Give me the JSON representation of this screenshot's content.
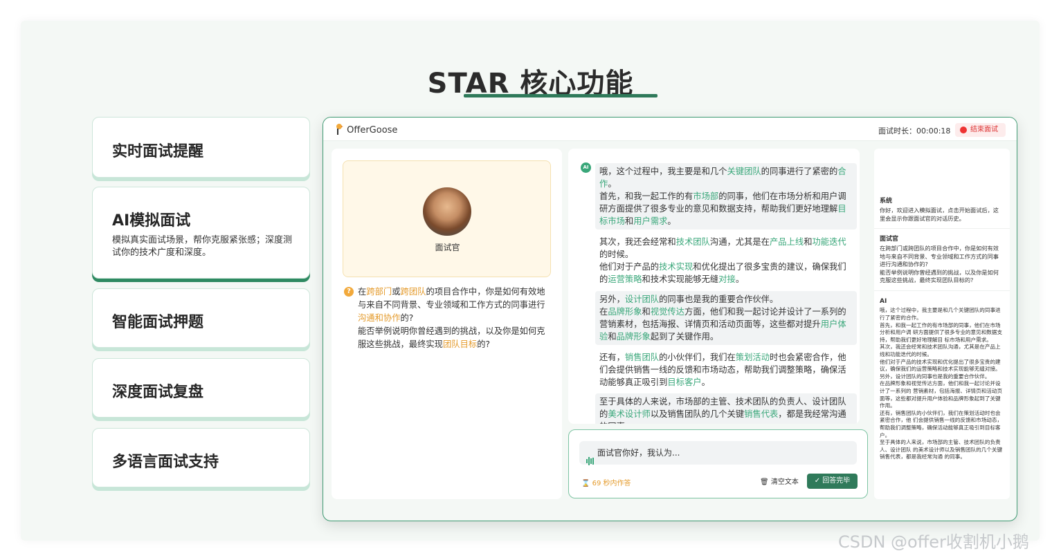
{
  "page_title": "STAR 核心功能",
  "features": [
    {
      "title": "实时面试提醒",
      "desc": ""
    },
    {
      "title": "AI模拟面试",
      "desc": "模拟真实面试场景，帮你克服紧张感；深度测试你的技术广度和深度。"
    },
    {
      "title": "智能面试押题",
      "desc": ""
    },
    {
      "title": "深度面试复盘",
      "desc": ""
    },
    {
      "title": "多语言面试支持",
      "desc": ""
    }
  ],
  "app": {
    "brand": "OfferGoose",
    "timer_label": "面试时长：00:00:18",
    "end_button": "结束面试",
    "interviewer_label": "面试官",
    "question_segments": [
      {
        "t": "在",
        "c": ""
      },
      {
        "t": "跨部门",
        "c": "o"
      },
      {
        "t": "或",
        "c": ""
      },
      {
        "t": "跨团队",
        "c": "o"
      },
      {
        "t": "的项目合作中，你是如何有效地与来自不同背景、专业领域和工作方式的同事进行",
        "c": ""
      },
      {
        "t": "沟通和协作",
        "c": "o"
      },
      {
        "t": "的?",
        "c": ""
      },
      {
        "t": "\n能否举例说明你曾经遇到的挑战，以及你是如何克服这些挑战，最终实现",
        "c": ""
      },
      {
        "t": "团队目标",
        "c": "o"
      },
      {
        "t": "的?",
        "c": ""
      }
    ],
    "ai_badge": "AI",
    "answer_blocks": [
      {
        "gray": true,
        "segments": [
          {
            "t": "哦，这个过程中，我主要是和几个",
            "c": ""
          },
          {
            "t": "关键团队",
            "c": "g"
          },
          {
            "t": "的同事进行了紧密的",
            "c": ""
          },
          {
            "t": "合作",
            "c": "g"
          },
          {
            "t": "。\n首先，和我一起工作的有",
            "c": ""
          },
          {
            "t": "市场部",
            "c": "g"
          },
          {
            "t": "的同事，他们在市场分析和用户调研方面提供了很多专业的意见和数据支持，帮助我们更好地理解",
            "c": ""
          },
          {
            "t": "目标市场",
            "c": "g"
          },
          {
            "t": "和",
            "c": ""
          },
          {
            "t": "用户需求",
            "c": "g"
          },
          {
            "t": "。",
            "c": ""
          }
        ]
      },
      {
        "gray": false,
        "segments": [
          {
            "t": "其次，我还会经常和",
            "c": ""
          },
          {
            "t": "技术团队",
            "c": "g"
          },
          {
            "t": "沟通，尤其是在",
            "c": ""
          },
          {
            "t": "产品上线",
            "c": "g"
          },
          {
            "t": "和",
            "c": ""
          },
          {
            "t": "功能迭代",
            "c": "g"
          },
          {
            "t": "的时候。\n他们对于产品的",
            "c": ""
          },
          {
            "t": "技术实现",
            "c": "g"
          },
          {
            "t": "和优化提出了很多宝贵的建议，确保我们的",
            "c": ""
          },
          {
            "t": "运营策略",
            "c": "g"
          },
          {
            "t": "和技术实现能够无缝",
            "c": ""
          },
          {
            "t": "对接",
            "c": "g"
          },
          {
            "t": "。",
            "c": ""
          }
        ]
      },
      {
        "gray": true,
        "segments": [
          {
            "t": "另外，",
            "c": ""
          },
          {
            "t": "设计团队",
            "c": "g"
          },
          {
            "t": "的同事也是我的重要合作伙伴。\n在",
            "c": ""
          },
          {
            "t": "品牌形象",
            "c": "g"
          },
          {
            "t": "和",
            "c": ""
          },
          {
            "t": "视觉传达",
            "c": "g"
          },
          {
            "t": "方面，他们和我一起讨论并设计了一系列的营销素材，包括海报、详情页和活动页面等，这些都对提升",
            "c": ""
          },
          {
            "t": "用户体验",
            "c": "g"
          },
          {
            "t": "和",
            "c": ""
          },
          {
            "t": "品牌形象",
            "c": "g"
          },
          {
            "t": "起到了关键作用。",
            "c": ""
          }
        ]
      },
      {
        "gray": false,
        "segments": [
          {
            "t": "还有，",
            "c": ""
          },
          {
            "t": "销售团队",
            "c": "g"
          },
          {
            "t": "的小伙伴们，我们在",
            "c": ""
          },
          {
            "t": "策划活动",
            "c": "g"
          },
          {
            "t": "时也会紧密合作，他们会提供销售一线的反馈和市场动态，帮助我们调整策略，确保活动能够真正吸引到",
            "c": ""
          },
          {
            "t": "目标客户",
            "c": "g"
          },
          {
            "t": "。",
            "c": ""
          }
        ]
      },
      {
        "gray": true,
        "segments": [
          {
            "t": "至于具体的人来说，市场部的主管、技术团队的负责人、设计团队的",
            "c": ""
          },
          {
            "t": "美术设计师",
            "c": "g"
          },
          {
            "t": "以及销售团队的几个关键",
            "c": ""
          },
          {
            "t": "销售代表",
            "c": "g"
          },
          {
            "t": "，都是我经常沟通的同事。",
            "c": ""
          }
        ]
      }
    ],
    "input_text": "面试官你好，我认为...",
    "countdown": "69 秒内作答",
    "clear_label": "清空文本",
    "done_label": "回答完毕",
    "history": [
      {
        "role": "系统",
        "text": "你好，欢迎进入模拟面试，点击开始面试后，这里会显示你跟面试官的对话历史。"
      },
      {
        "role": "面试官",
        "text": "在跨部门或跨团队的项目合作中，你是如何有效地与来自不同背景、专业领域和工作方式的同事进行沟通和协作的?\n能否举例说明你曾经遇到的挑战，以及你是如何克服这些挑战，最终实现团队目标的?"
      },
      {
        "role": "AI",
        "text": "哦，这个过程中，我主要是和几个关键团队的同事进行了紧密的合作。\n首先，和我一起工作的有市场部的同事，他们在市场分析和用户调 研方面提供了很多专业的意见和数据支持，帮助我们更好地理解目 标市场和用户需求。\n其次，我还会经常和技术团队沟通，尤其是在产品上线和功能迭代的时候。\n他们对于产品的技术实现和优化提出了很多宝贵的建议，确保我们的运营策略和技术实现能够无缝对接。\n另外，设计团队的同事也是我的重要合作伙伴。\n在品牌形象和视觉传达方面，他们和我一起讨论并设计了一系列的 营销素材，包括海报、详情页和活动页面等，这些都对提升用户体验和品牌形象起到了关键作用。\n还有，销售团队的小伙伴们，我们在策划活动时也会紧密合作，他 们会提供销售一线的反馈和市场动态，帮助我们调整策略，确保活动能够真正吸引到目标客户。\n至于具体的人来说，市场部的主管、技术团队的负责人、设计团队 的美术设计师以及销售团队的几个关键销售代表，都是我经常沟通 的同事。"
      }
    ]
  },
  "watermark": "CSDN @offer收割机小鹅",
  "colors": {
    "accent": "#2f7a5a",
    "highlight_green": "#3aa77a",
    "highlight_orange": "#e49a2a",
    "end_red": "#e33333"
  }
}
